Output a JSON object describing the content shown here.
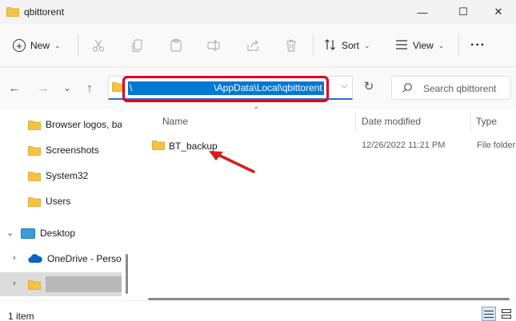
{
  "window": {
    "title": "qbittorent",
    "minimize_glyph": "—",
    "maximize_glyph": "☐",
    "close_glyph": "✕"
  },
  "commandbar": {
    "new_label": "New",
    "sort_label": "Sort",
    "view_label": "View",
    "more_glyph": "···",
    "tools": [
      "cut-icon",
      "copy-icon",
      "paste-icon",
      "rename-icon",
      "share-icon",
      "delete-icon"
    ]
  },
  "nav_buttons": {
    "back": "←",
    "forward": "→",
    "recent": "⌄",
    "up": "↑",
    "refresh": "↻"
  },
  "address": {
    "path": "\\AppData\\Local\\qbittorent",
    "leading": "\\",
    "dropdown": "⌵"
  },
  "search": {
    "placeholder": "Search qbittorent"
  },
  "navpane": {
    "items": [
      {
        "label": "Browser logos, bar",
        "icon": "folder-icon"
      },
      {
        "label": "Screenshots",
        "icon": "folder-icon"
      },
      {
        "label": "System32",
        "icon": "folder-icon"
      },
      {
        "label": "Users",
        "icon": "folder-icon"
      },
      {
        "label": "Desktop",
        "icon": "desktop-icon",
        "expand": "⌄"
      },
      {
        "label": "OneDrive - Person",
        "icon": "onedrive-icon",
        "expand": "›"
      },
      {
        "label": "",
        "icon": "folder-icon",
        "expand": "›",
        "redacted": true
      }
    ]
  },
  "columns": {
    "name": "Name",
    "date": "Date modified",
    "type": "Type",
    "sort_caret": "⌃"
  },
  "files": [
    {
      "name": "BT_backup",
      "date": "12/26/2022 11:21 PM",
      "type": "File folder"
    }
  ],
  "status": {
    "count": "1 item"
  },
  "colors": {
    "accent": "#0078d4",
    "highlight": "#e0001b",
    "folder": "#f5c242"
  }
}
